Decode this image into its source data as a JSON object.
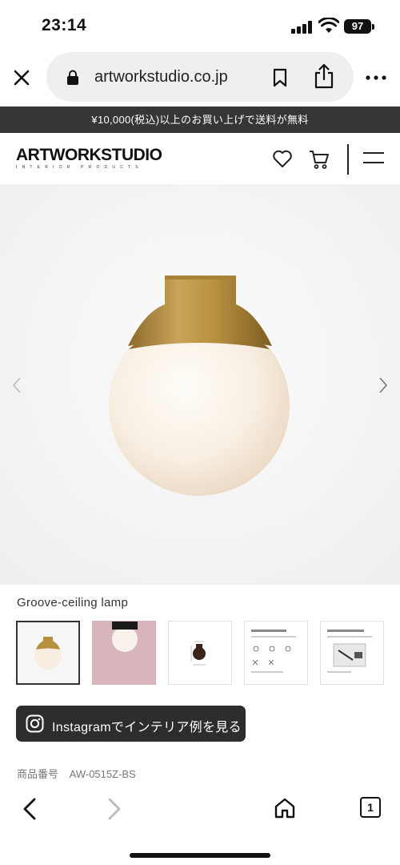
{
  "status_bar": {
    "time": "23:14",
    "battery": "97"
  },
  "browser": {
    "url": "artworkstudio.co.jp",
    "icons": [
      "close-icon",
      "lock-icon",
      "bookmark-icon",
      "share-icon",
      "more-icon"
    ]
  },
  "announcement": {
    "text": "¥10,000(税込)以上のお買い上げで送料が無料"
  },
  "header": {
    "logo_main": "ARTWORKSTUDIO",
    "logo_sub": "INTERIOR PRODUCTS",
    "icons": [
      "heart-icon",
      "cart-icon",
      "menu-icon"
    ]
  },
  "product": {
    "name": "Groove-ceiling lamp",
    "thumbnail_count": 5,
    "instagram_label": "Instagramでインテリア例を見る",
    "sku_label": "商品番号",
    "sku_value": "AW-0515Z-BS"
  },
  "bottom_nav": {
    "tab_count": "1",
    "icons": [
      "back-icon",
      "forward-icon",
      "home-icon",
      "tabs-icon"
    ]
  },
  "colors": {
    "banner_bg": "#363636",
    "button_bg": "#2d2d2d",
    "brass": "#b08a3e",
    "globe": "#f7efe6",
    "url_pill": "#eeeff1"
  }
}
